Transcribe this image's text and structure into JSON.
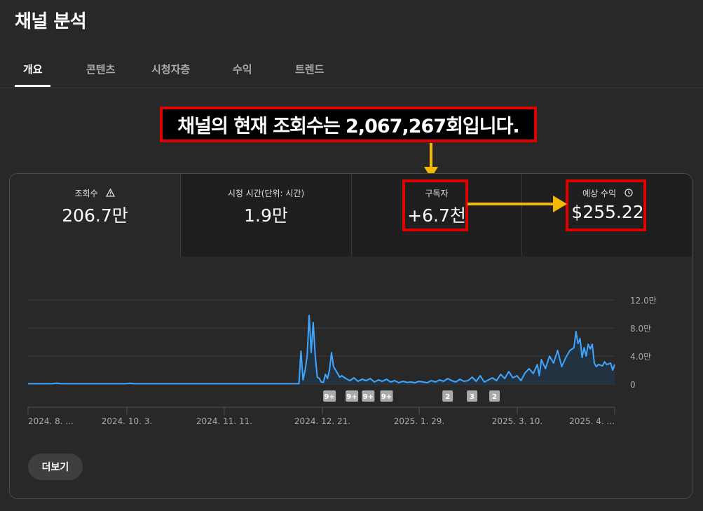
{
  "page": {
    "title": "채널 분석"
  },
  "tabs": [
    {
      "label": "개요",
      "active": true
    },
    {
      "label": "콘텐츠",
      "active": false
    },
    {
      "label": "시청자층",
      "active": false
    },
    {
      "label": "수익",
      "active": false
    },
    {
      "label": "트렌드",
      "active": false
    }
  ],
  "annotation": {
    "text": "채널의 현재 조회수는 2,067,267회입니다."
  },
  "metrics": [
    {
      "label": "조회수",
      "value": "206.7만",
      "icon": "warning-icon"
    },
    {
      "label": "시청 시간(단위: 시간)",
      "value": "1.9만"
    },
    {
      "label": "구독자",
      "value": "+6.7천"
    },
    {
      "label": "예상 수익",
      "value": "$255.22",
      "icon": "clock-icon"
    }
  ],
  "colors": {
    "line": "#3ea6ff",
    "highlight": "#e00000",
    "arrow": "#f5b800"
  },
  "chart_data": {
    "type": "area",
    "y_ticks": [
      "0",
      "4.0만",
      "8.0만",
      "12.0만"
    ],
    "ylim": [
      0,
      120000
    ],
    "x_tick_labels": [
      "2024. 8. ...",
      "2024. 10. 3.",
      "2024. 11. 11.",
      "2024. 12. 21.",
      "2025. 1. 29.",
      "2025. 3. 10.",
      "2025. 4. ..."
    ],
    "markers": [
      {
        "day": 148,
        "label": "9+"
      },
      {
        "day": 159,
        "label": "9+"
      },
      {
        "day": 167,
        "label": "9+"
      },
      {
        "day": 176,
        "label": "9+"
      },
      {
        "day": 206,
        "label": "2"
      },
      {
        "day": 218,
        "label": "3"
      },
      {
        "day": 229,
        "label": "2"
      }
    ],
    "series": [
      {
        "values": [
          [
            0,
            600
          ],
          [
            12,
            600
          ],
          [
            14,
            1400
          ],
          [
            16,
            600
          ],
          [
            48,
            600
          ],
          [
            50,
            1200
          ],
          [
            52,
            600
          ],
          [
            133,
            600
          ],
          [
            134,
            47000
          ],
          [
            135,
            6000
          ],
          [
            136,
            20000
          ],
          [
            137,
            40000
          ],
          [
            138,
            98000
          ],
          [
            139,
            45000
          ],
          [
            140,
            88000
          ],
          [
            141,
            40000
          ],
          [
            142,
            10000
          ],
          [
            143,
            8000
          ],
          [
            144,
            3000
          ],
          [
            145,
            2500
          ],
          [
            146,
            14000
          ],
          [
            147,
            8000
          ],
          [
            148,
            20000
          ],
          [
            149,
            45000
          ],
          [
            150,
            25000
          ],
          [
            151,
            20000
          ],
          [
            152,
            15000
          ],
          [
            153,
            10000
          ],
          [
            154,
            12000
          ],
          [
            156,
            8000
          ],
          [
            158,
            5000
          ],
          [
            160,
            9000
          ],
          [
            162,
            4000
          ],
          [
            164,
            7000
          ],
          [
            166,
            5000
          ],
          [
            168,
            8000
          ],
          [
            170,
            3000
          ],
          [
            172,
            6000
          ],
          [
            174,
            4000
          ],
          [
            176,
            7000
          ],
          [
            178,
            3000
          ],
          [
            180,
            5000
          ],
          [
            182,
            2000
          ],
          [
            184,
            4000
          ],
          [
            186,
            2500
          ],
          [
            188,
            3000
          ],
          [
            190,
            2000
          ],
          [
            192,
            4000
          ],
          [
            194,
            3000
          ],
          [
            196,
            2000
          ],
          [
            198,
            5000
          ],
          [
            200,
            3000
          ],
          [
            202,
            6000
          ],
          [
            204,
            4000
          ],
          [
            206,
            8000
          ],
          [
            208,
            5000
          ],
          [
            210,
            3000
          ],
          [
            212,
            7000
          ],
          [
            214,
            4000
          ],
          [
            216,
            5000
          ],
          [
            218,
            10000
          ],
          [
            220,
            4000
          ],
          [
            222,
            12000
          ],
          [
            224,
            3000
          ],
          [
            226,
            6000
          ],
          [
            228,
            9000
          ],
          [
            230,
            5000
          ],
          [
            232,
            14000
          ],
          [
            234,
            8000
          ],
          [
            236,
            18000
          ],
          [
            238,
            9000
          ],
          [
            240,
            12000
          ],
          [
            242,
            5000
          ],
          [
            244,
            16000
          ],
          [
            246,
            22000
          ],
          [
            248,
            15000
          ],
          [
            250,
            28000
          ],
          [
            251,
            12000
          ],
          [
            252,
            35000
          ],
          [
            254,
            22000
          ],
          [
            256,
            40000
          ],
          [
            258,
            30000
          ],
          [
            260,
            48000
          ],
          [
            262,
            25000
          ],
          [
            264,
            38000
          ],
          [
            266,
            48000
          ],
          [
            268,
            52000
          ],
          [
            269,
            75000
          ],
          [
            270,
            58000
          ],
          [
            271,
            65000
          ],
          [
            272,
            38000
          ],
          [
            273,
            52000
          ],
          [
            274,
            40000
          ],
          [
            275,
            57000
          ],
          [
            276,
            50000
          ],
          [
            277,
            57000
          ],
          [
            278,
            30000
          ],
          [
            279,
            25000
          ],
          [
            280,
            28000
          ],
          [
            282,
            26000
          ],
          [
            283,
            32000
          ],
          [
            284,
            28000
          ],
          [
            286,
            30000
          ],
          [
            287,
            20000
          ],
          [
            288,
            28000
          ]
        ]
      }
    ]
  },
  "more_button": {
    "label": "더보기"
  }
}
